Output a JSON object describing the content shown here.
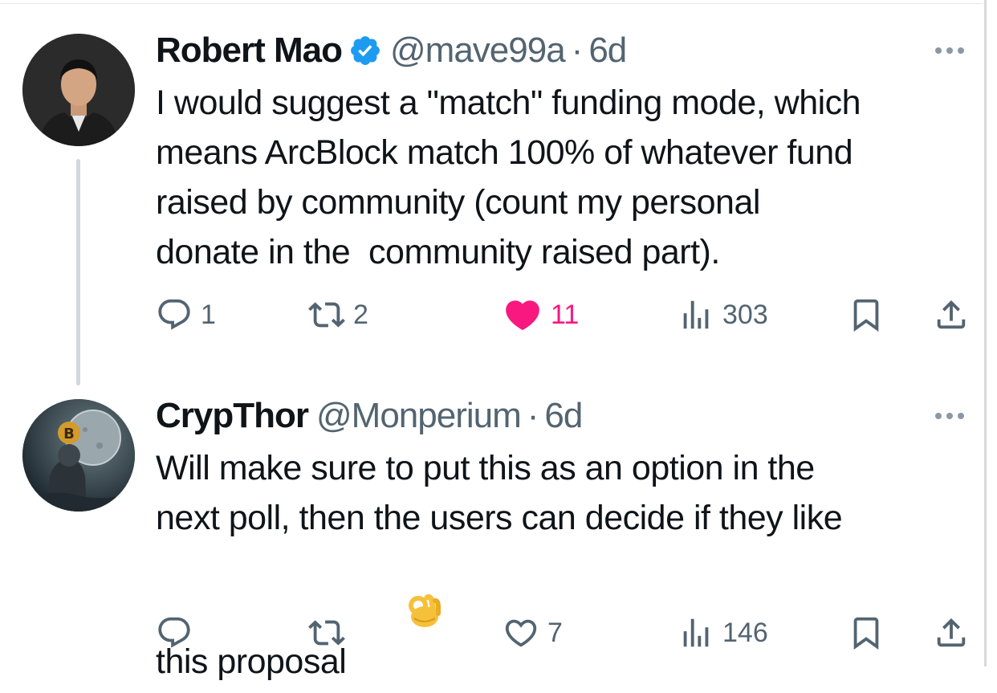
{
  "tweets": [
    {
      "display_name": "Robert Mao",
      "verified": true,
      "handle": "@mave99a",
      "separator": "·",
      "time": "6d",
      "text_lines": [
        "I would suggest a \"match\" funding mode, which",
        "means ArcBlock match 100% of whatever fund",
        "raised by community (count my personal",
        "donate in the  community raised part)."
      ],
      "replies": "1",
      "retweets": "2",
      "likes": "11",
      "liked": true,
      "views": "303"
    },
    {
      "display_name": "CrypThor",
      "verified": false,
      "handle": "@Monperium",
      "separator": "·",
      "time": "6d",
      "text_lines": [
        "Will make sure to put this as an option in the",
        "next poll, then the users can decide if they like",
        "this proposal"
      ],
      "emoji": "ok-hand",
      "replies": "",
      "retweets": "",
      "likes": "7",
      "liked": false,
      "views": "146"
    }
  ],
  "colors": {
    "text": "#0f1419",
    "secondary": "#536471",
    "like": "#f91880",
    "verified": "#1d9bf0",
    "thread_line": "#cfd9de"
  },
  "icons": [
    "reply-icon",
    "retweet-icon",
    "heart-icon",
    "views-icon",
    "bookmark-icon",
    "share-icon",
    "more-icon",
    "verified-icon"
  ]
}
